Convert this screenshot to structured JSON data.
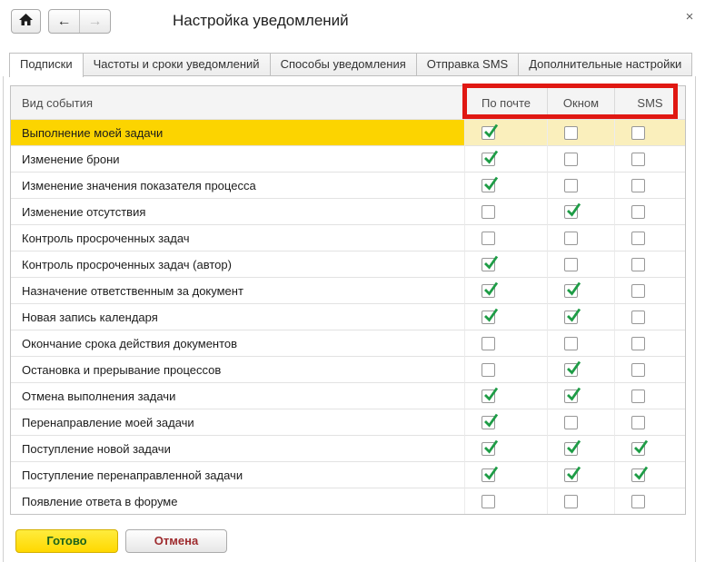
{
  "window": {
    "title": "Настройка уведомлений"
  },
  "icons": {
    "home": "⌂",
    "back": "←",
    "forward": "→",
    "close": "×",
    "check": "✓"
  },
  "tabs": [
    {
      "label": "Подписки",
      "active": true
    },
    {
      "label": "Частоты и сроки уведомлений",
      "active": false
    },
    {
      "label": "Способы уведомления",
      "active": false
    },
    {
      "label": "Отправка SMS",
      "active": false
    },
    {
      "label": "Дополнительные настройки",
      "active": false
    }
  ],
  "table": {
    "columns": {
      "event": "Вид события",
      "email": "По почте",
      "window": "Окном",
      "sms": "SMS"
    },
    "rows": [
      {
        "label": "Выполнение моей задачи",
        "email": true,
        "window": false,
        "sms": false,
        "selected": true
      },
      {
        "label": "Изменение брони",
        "email": true,
        "window": false,
        "sms": false,
        "selected": false
      },
      {
        "label": "Изменение значения показателя процесса",
        "email": true,
        "window": false,
        "sms": false,
        "selected": false
      },
      {
        "label": "Изменение отсутствия",
        "email": false,
        "window": true,
        "sms": false,
        "selected": false
      },
      {
        "label": "Контроль просроченных задач",
        "email": false,
        "window": false,
        "sms": false,
        "selected": false
      },
      {
        "label": "Контроль просроченных задач (автор)",
        "email": true,
        "window": false,
        "sms": false,
        "selected": false
      },
      {
        "label": "Назначение ответственным за документ",
        "email": true,
        "window": true,
        "sms": false,
        "selected": false
      },
      {
        "label": "Новая запись календаря",
        "email": true,
        "window": true,
        "sms": false,
        "selected": false
      },
      {
        "label": "Окончание срока действия документов",
        "email": false,
        "window": false,
        "sms": false,
        "selected": false
      },
      {
        "label": "Остановка и прерывание процессов",
        "email": false,
        "window": true,
        "sms": false,
        "selected": false
      },
      {
        "label": "Отмена выполнения задачи",
        "email": true,
        "window": true,
        "sms": false,
        "selected": false
      },
      {
        "label": "Перенаправление моей задачи",
        "email": true,
        "window": false,
        "sms": false,
        "selected": false
      },
      {
        "label": "Поступление новой задачи",
        "email": true,
        "window": true,
        "sms": true,
        "selected": false
      },
      {
        "label": "Поступление перенаправленной задачи",
        "email": true,
        "window": true,
        "sms": true,
        "selected": false
      },
      {
        "label": "Появление ответа в форуме",
        "email": false,
        "window": false,
        "sms": false,
        "selected": false
      }
    ]
  },
  "footer": {
    "done_label": "Готово",
    "cancel_label": "Отмена"
  },
  "colors": {
    "selected_row": "#FCD400",
    "selected_row_light": "#FAEFBC",
    "annotation_red": "#E01812",
    "check_green": "#1E9C46",
    "done_button": "#FFD800",
    "done_text": "#1B621B",
    "cancel_text": "#9E2B2E"
  }
}
